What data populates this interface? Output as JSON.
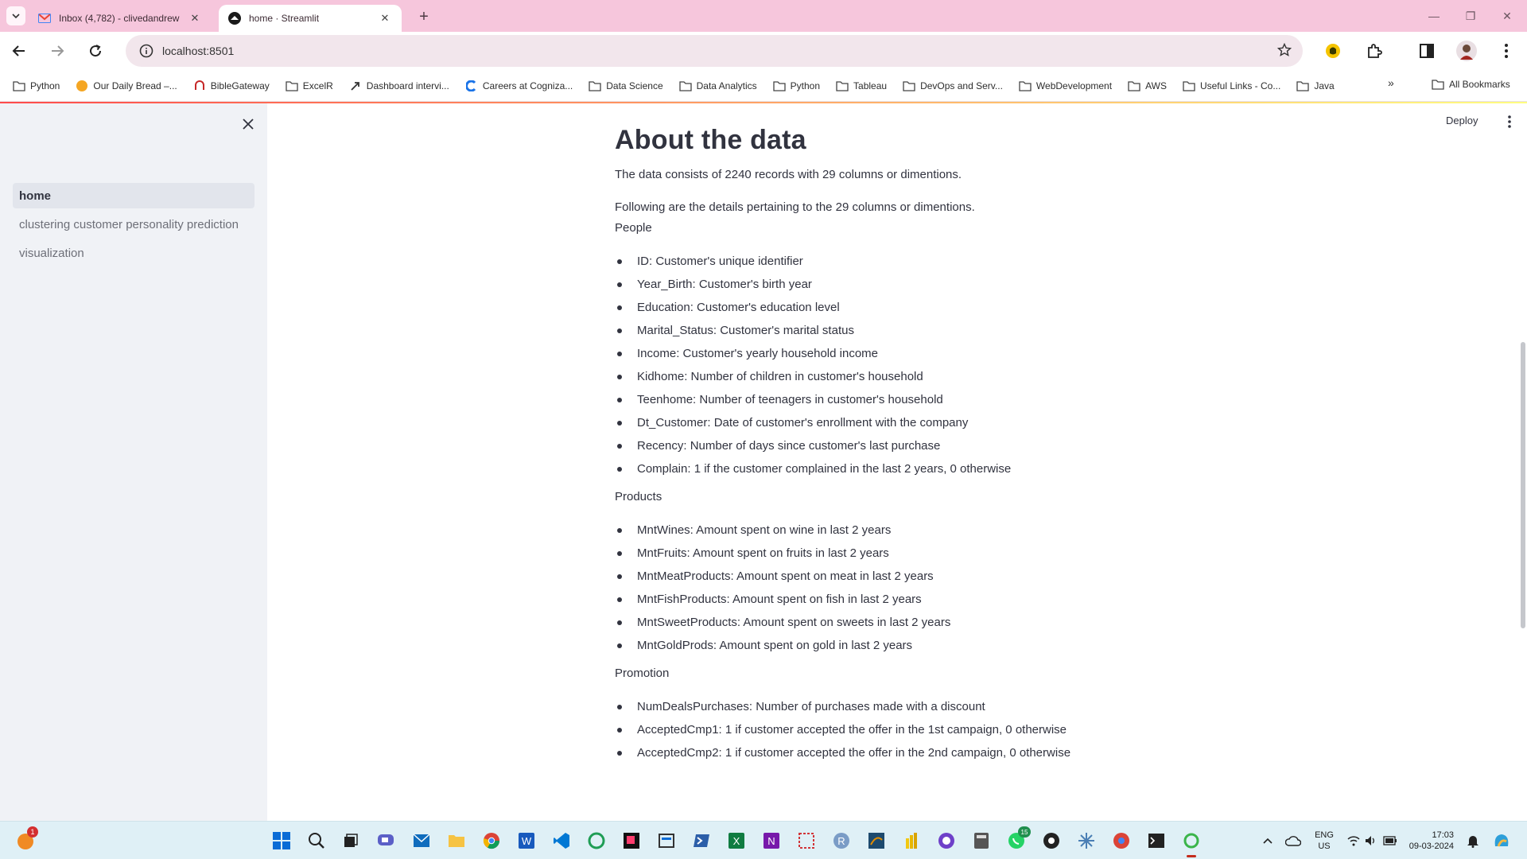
{
  "browser": {
    "tabs": [
      {
        "title": "Inbox (4,782) - clivedandrew",
        "favicon": "gmail-icon",
        "active": false
      },
      {
        "title": "home · Streamlit",
        "favicon": "streamlit-icon",
        "active": true
      }
    ],
    "url": "localhost:8501",
    "bookmarks": [
      {
        "label": "Python",
        "icon": "folder-icon"
      },
      {
        "label": "Our Daily Bread –...",
        "icon": "odb-icon"
      },
      {
        "label": "BibleGateway",
        "icon": "biblegateway-icon"
      },
      {
        "label": "ExcelR",
        "icon": "folder-icon"
      },
      {
        "label": "Dashboard intervi...",
        "icon": "link-icon"
      },
      {
        "label": "Careers at Cogniza...",
        "icon": "cognizant-icon"
      },
      {
        "label": "Data Science",
        "icon": "folder-icon"
      },
      {
        "label": "Data Analytics",
        "icon": "folder-icon"
      },
      {
        "label": "Python",
        "icon": "folder-icon"
      },
      {
        "label": "Tableau",
        "icon": "folder-icon"
      },
      {
        "label": "DevOps and Serv...",
        "icon": "folder-icon"
      },
      {
        "label": "WebDevelopment",
        "icon": "folder-icon"
      },
      {
        "label": "AWS",
        "icon": "folder-icon"
      },
      {
        "label": "Useful Links - Co...",
        "icon": "folder-icon"
      },
      {
        "label": "Java",
        "icon": "folder-icon"
      }
    ],
    "more_bookmarks": "»",
    "all_bookmarks": "All Bookmarks"
  },
  "sidebar": {
    "items": [
      {
        "label": "home",
        "active": true
      },
      {
        "label": "clustering customer personality prediction",
        "active": false
      },
      {
        "label": "visualization",
        "active": false
      }
    ]
  },
  "header": {
    "deploy_label": "Deploy"
  },
  "main": {
    "title": "About the data",
    "intro1": "The data consists of 2240 records with 29 columns or dimentions.",
    "intro2": "Following are the details pertaining to the 29 columns or dimentions.",
    "sections": [
      {
        "heading": "People",
        "items": [
          "ID: Customer's unique identifier",
          "Year_Birth: Customer's birth year",
          "Education: Customer's education level",
          "Marital_Status: Customer's marital status",
          "Income: Customer's yearly household income",
          "Kidhome: Number of children in customer's household",
          "Teenhome: Number of teenagers in customer's household",
          "Dt_Customer: Date of customer's enrollment with the company",
          "Recency: Number of days since customer's last purchase",
          "Complain: 1 if the customer complained in the last 2 years, 0 otherwise"
        ]
      },
      {
        "heading": "Products",
        "items": [
          "MntWines: Amount spent on wine in last 2 years",
          "MntFruits: Amount spent on fruits in last 2 years",
          "MntMeatProducts: Amount spent on meat in last 2 years",
          "MntFishProducts: Amount spent on fish in last 2 years",
          "MntSweetProducts: Amount spent on sweets in last 2 years",
          "MntGoldProds: Amount spent on gold in last 2 years"
        ]
      },
      {
        "heading": "Promotion",
        "items": [
          "NumDealsPurchases: Number of purchases made with a discount",
          "AcceptedCmp1: 1 if customer accepted the offer in the 1st campaign, 0 otherwise",
          "AcceptedCmp2: 1 if customer accepted the offer in the 2nd campaign, 0 otherwise"
        ]
      }
    ]
  },
  "taskbar": {
    "notification_badge": "1",
    "whatsapp_badge": "15",
    "language_line1": "ENG",
    "language_line2": "US",
    "time": "17:03",
    "date": "09-03-2024"
  }
}
